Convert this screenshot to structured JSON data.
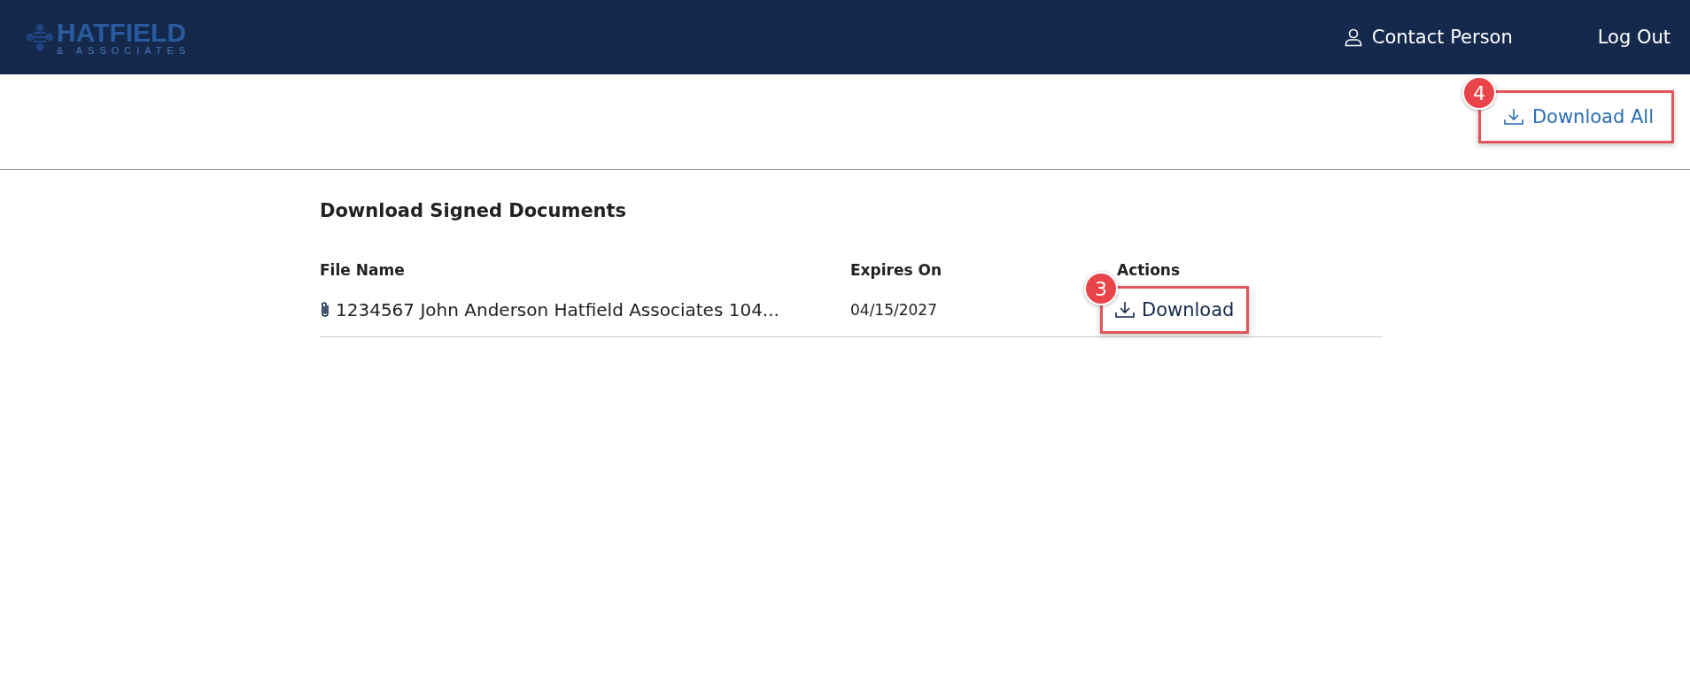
{
  "header": {
    "logo": {
      "name": "HATFIELD",
      "tagline": "& ASSOCIATES"
    },
    "user": "Contact Person",
    "logout": "Log Out"
  },
  "toolbar": {
    "download_all": "Download All",
    "callout": "4"
  },
  "page": {
    "title": "Download Signed Documents",
    "table": {
      "columns": [
        "File Name",
        "Expires On",
        "Actions"
      ],
      "rows": [
        {
          "file_name": "1234567 John Anderson Hatfield Associates 104...",
          "expires_on": "04/15/2027",
          "action": "Download",
          "callout": "3"
        }
      ]
    }
  }
}
